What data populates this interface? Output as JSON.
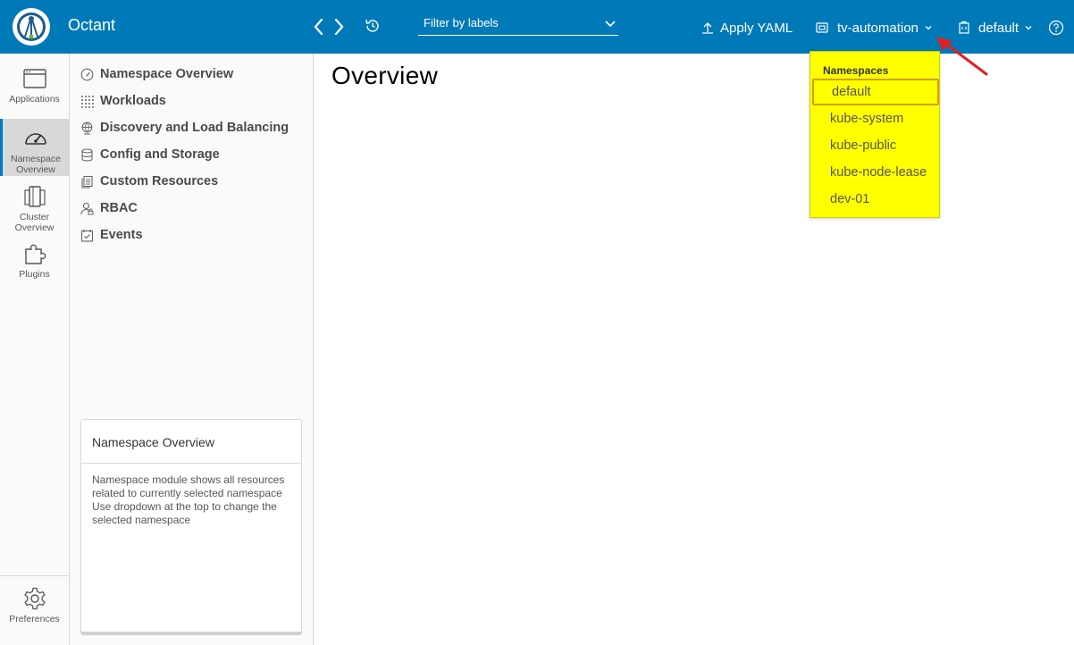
{
  "header": {
    "app_title": "Octant",
    "filter_placeholder": "Filter by labels",
    "apply_yaml": "Apply YAML",
    "context": "tv-automation",
    "namespace": "default",
    "icons": [
      "octant-logo-icon",
      "back-arrow-icon",
      "forward-arrow-icon",
      "history-icon",
      "chevron-down-icon",
      "upload-icon",
      "context-icon",
      "building-icon",
      "help-icon"
    ],
    "color": "#0079b8"
  },
  "rail": {
    "items": [
      {
        "label": "Applications",
        "icon": "window-icon"
      },
      {
        "label": "Namespace Overview",
        "icon": "dashboard-icon",
        "active": true
      },
      {
        "label": "Cluster Overview",
        "icon": "cluster-icon"
      },
      {
        "label": "Plugins",
        "icon": "puzzle-icon"
      }
    ],
    "preferences": "Preferences",
    "accent": "#0079b8"
  },
  "subnav": {
    "items": [
      {
        "label": "Namespace Overview",
        "icon": "gauge-icon"
      },
      {
        "label": "Workloads",
        "icon": "grid-icon"
      },
      {
        "label": "Discovery and Load Balancing",
        "icon": "network-icon"
      },
      {
        "label": "Config and Storage",
        "icon": "storage-icon"
      },
      {
        "label": "Custom Resources",
        "icon": "documents-icon"
      },
      {
        "label": "RBAC",
        "icon": "user-icon"
      },
      {
        "label": "Events",
        "icon": "calendar-icon"
      }
    ]
  },
  "info_card": {
    "title": "Namespace Overview",
    "body": "Namespace module shows all resources related to currently selected namespace Use dropdown at the top to change the selected namespace"
  },
  "main": {
    "title": "Overview"
  },
  "dropdown": {
    "header": "Namespaces",
    "items": [
      "default",
      "kube-system",
      "kube-public",
      "kube-node-lease",
      "dev-01"
    ],
    "selected": "default",
    "highlight": "#ffff00",
    "annotation_color": "#e02020"
  }
}
